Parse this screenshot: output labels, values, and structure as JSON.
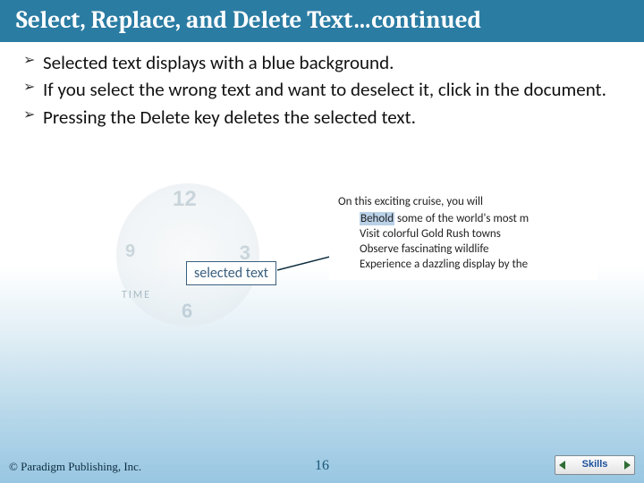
{
  "title": "Select, Replace, and Delete Text…continued",
  "bullets": [
    "Selected text displays with a blue background.",
    "If you select the wrong text and want to deselect it, click in the document.",
    "Pressing the Delete key deletes the selected text."
  ],
  "clock": {
    "n12": "12",
    "n3": "3",
    "n6": "6",
    "n9": "9",
    "time_label": "TIME"
  },
  "callout_label": "selected text",
  "doc": {
    "intro": "On this exciting cruise, you will",
    "items": [
      {
        "pre": "",
        "hl": "Behold",
        "post": " some of the world's most m"
      },
      {
        "pre": "Visit colorful Gold Rush towns",
        "hl": "",
        "post": ""
      },
      {
        "pre": "Observe fascinating wildlife",
        "hl": "",
        "post": ""
      },
      {
        "pre": "Experience a dazzling display by the",
        "hl": "",
        "post": ""
      }
    ]
  },
  "footer": {
    "copyright": "© Paradigm Publishing, Inc.",
    "page": "16",
    "skills": "Skills"
  }
}
